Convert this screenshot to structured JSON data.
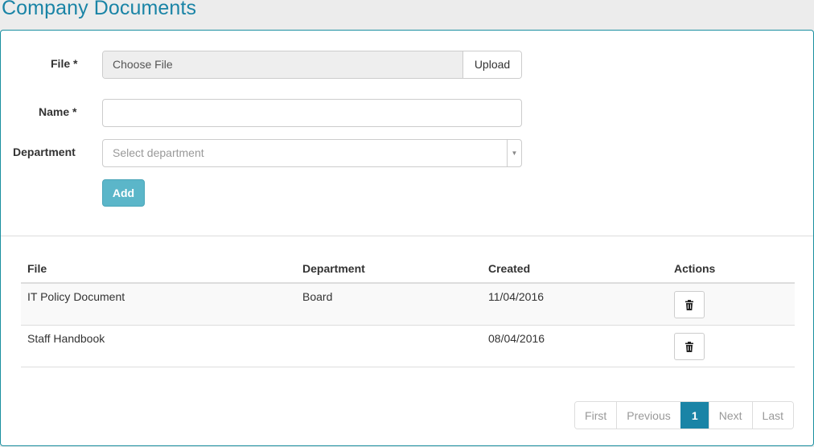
{
  "page": {
    "title": "Company Documents"
  },
  "form": {
    "file_label": "File *",
    "file_placeholder": "Choose File",
    "upload_label": "Upload",
    "name_label": "Name *",
    "name_value": "",
    "department_label": "Department",
    "department_placeholder": "Select department",
    "add_label": "Add"
  },
  "table": {
    "headers": {
      "file": "File",
      "department": "Department",
      "created": "Created",
      "actions": "Actions"
    },
    "rows": [
      {
        "file": "IT Policy Document",
        "department": "Board",
        "created": "11/04/2016",
        "action_icon": "trash-icon"
      },
      {
        "file": "Staff Handbook",
        "department": "",
        "created": "08/04/2016",
        "action_icon": "trash-icon"
      }
    ]
  },
  "pagination": {
    "first": "First",
    "previous": "Previous",
    "current": "1",
    "next": "Next",
    "last": "Last"
  },
  "colors": {
    "accent": "#1a84a6",
    "add_button": "#5bb6c9",
    "panel_border": "#1a8fa0"
  }
}
